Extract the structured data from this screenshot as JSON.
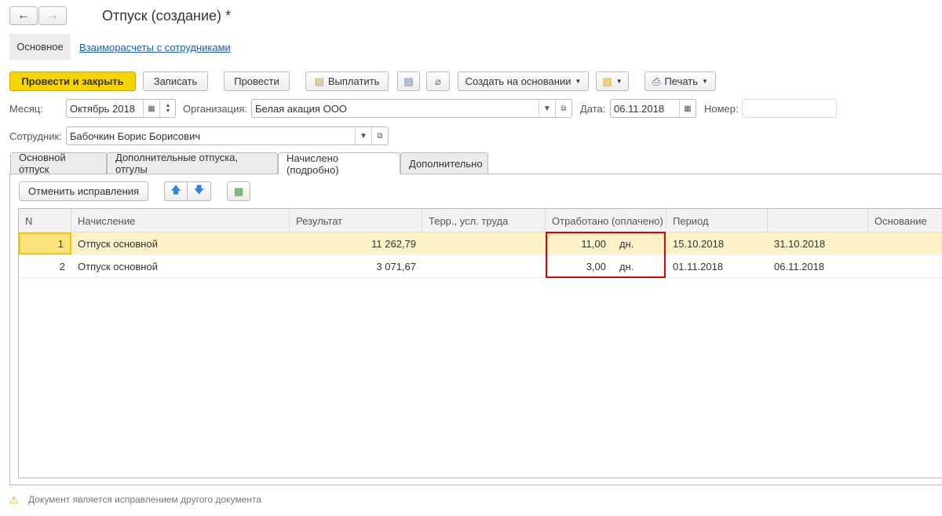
{
  "title": "Отпуск (создание) *",
  "nav": {
    "back": "←",
    "forward": "→"
  },
  "sections": [
    "Основное",
    "Взаиморасчеты с сотрудниками"
  ],
  "toolbar": {
    "post_close": "Провести и закрыть",
    "save": "Записать",
    "post": "Провести",
    "pay": "Выплатить",
    "create_based": "Создать на основании",
    "print": "Печать"
  },
  "form": {
    "month_label": "Месяц:",
    "month": "Октябрь 2018",
    "org_label": "Организация:",
    "org": "Белая акация ООО",
    "date_label": "Дата:",
    "date": "06.11.2018",
    "number_label": "Номер:",
    "number": "",
    "employee_label": "Сотрудник:",
    "employee": "Бабочкин Борис Борисович"
  },
  "tabs": [
    "Основной отпуск",
    "Дополнительные отпуска, отгулы",
    "Начислено (подробно)",
    "Дополнительно"
  ],
  "cancel_fix": "Отменить исправления",
  "table": {
    "headers": [
      "N",
      "Начисление",
      "Результат",
      "Терр., усл. труда",
      "Отработано (оплачено)",
      "Период",
      "",
      "Основание"
    ],
    "rows": [
      {
        "n": "1",
        "name": "Отпуск основной",
        "result": "11 262,79",
        "terr": "",
        "worked": "11,00",
        "unit": "дн.",
        "from": "15.10.2018",
        "to": "31.10.2018",
        "basis": ""
      },
      {
        "n": "2",
        "name": "Отпуск основной",
        "result": "3 071,67",
        "terr": "",
        "worked": "3,00",
        "unit": "дн.",
        "from": "01.11.2018",
        "to": "06.11.2018",
        "basis": ""
      }
    ]
  },
  "footer": "Документ является исправлением другого документа",
  "colors": {
    "primary": "#f5d400",
    "selected": "#fdf2c6",
    "highlight": "#e00000"
  }
}
